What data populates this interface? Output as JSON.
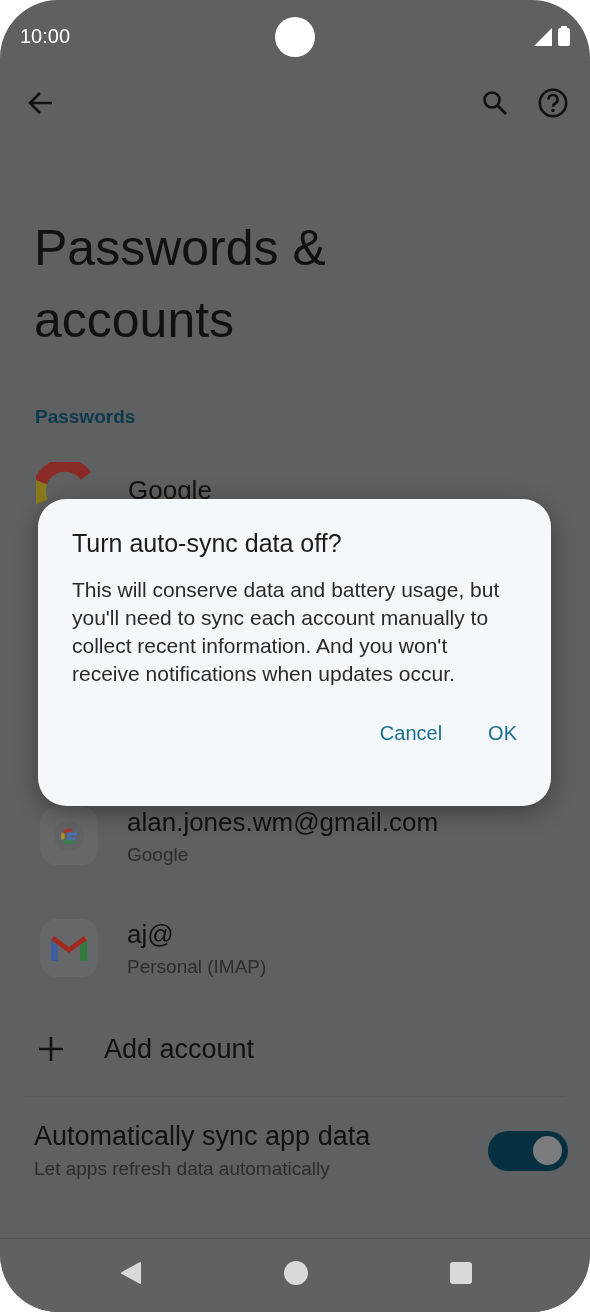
{
  "status_bar": {
    "time": "10:00"
  },
  "title": "Passwords & accounts",
  "passwords": {
    "header": "Passwords",
    "items": [
      {
        "name": "Google"
      }
    ]
  },
  "accounts": [
    {
      "kind": "google",
      "name": "alan.jones.wm@gmail.com",
      "type": "Google"
    },
    {
      "kind": "gmail",
      "name": "aj@",
      "type": "Personal (IMAP)"
    }
  ],
  "add_account": "Add account",
  "auto_sync": {
    "title": "Automatically sync app data",
    "subtitle": "Let apps refresh data automatically",
    "on": true
  },
  "dialog": {
    "title": "Turn auto-sync data off?",
    "message": "This will conserve data and battery usage, but you'll need to sync each account manually to collect recent information. And you won't receive notifications when updates occur.",
    "buttons": [
      {
        "label": "Cancel"
      },
      {
        "label": "OK"
      }
    ]
  }
}
